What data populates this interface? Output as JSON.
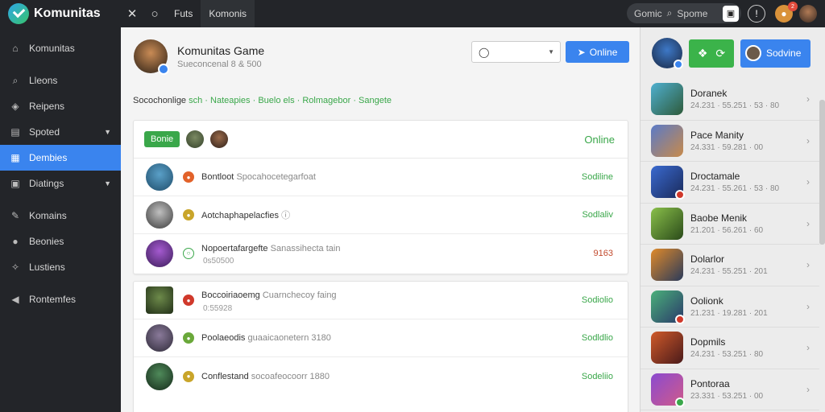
{
  "topbar": {
    "brand": "Komunitas",
    "links": [
      "Futs",
      "Komonis"
    ],
    "search_label": "Gomic",
    "search_placeholder": "Spome"
  },
  "sidebar": {
    "items": [
      {
        "label": "Komunitas",
        "icon": "home-icon"
      },
      {
        "label": "Lleons",
        "icon": "search-icon"
      },
      {
        "label": "Reipens",
        "icon": "shield-icon"
      },
      {
        "label": "Spoted",
        "icon": "store-icon",
        "caret": true
      },
      {
        "label": "Dembies",
        "icon": "tag-icon",
        "active": true
      },
      {
        "label": "Diatings",
        "icon": "calendar-icon",
        "caret": true
      },
      {
        "label": "Komains",
        "icon": "wrench-icon"
      },
      {
        "label": "Beonies",
        "icon": "user-icon"
      },
      {
        "label": "Lustiens",
        "icon": "group-icon"
      },
      {
        "label": "Rontemfes",
        "icon": "send-icon"
      }
    ]
  },
  "profile": {
    "title": "Komunitas Game",
    "subtitle": "Sueconcenal 8 & 500",
    "select_value": "",
    "online_button": "Online"
  },
  "tagline": {
    "part1": "Socochonlige",
    "part2": "sch · Nateapies · Buelo els · Rolmagebor · Sangete"
  },
  "card1": {
    "pill": "Bonie",
    "status": "Online",
    "rows": [
      {
        "text": "Bontloot",
        "muted": "Spocahocetegarfoat",
        "right": "Sodiline",
        "sub": ""
      },
      {
        "text": "Aotchaphapelacfies",
        "muted": "",
        "right": "Sodlaliv",
        "sub": ""
      },
      {
        "text": "Nopoertafargefte",
        "muted": "Sanassihecta tain",
        "right": "9163",
        "sub": "0s50500"
      }
    ]
  },
  "card2": {
    "rows": [
      {
        "text": "Boccoiriaoemg",
        "muted": "Cuarnchecoy faing",
        "right": "Sodiolio",
        "sub": "0:55928"
      },
      {
        "text": "Poolaeodis",
        "muted": "guaaicaonetern 3180",
        "right": "Sodldlio",
        "sub": ""
      },
      {
        "text": "Conflestand",
        "muted": "socoafeocoorr 1880",
        "right": "Sodeliio",
        "sub": ""
      }
    ]
  },
  "rpanel": {
    "button_label": "Sodvine",
    "items": [
      {
        "name": "Doranek",
        "meta": "24.231 · 55.251 · 53 · 80"
      },
      {
        "name": "Pace Manity",
        "meta": "24.331 · 59.281 · 00"
      },
      {
        "name": "Droctamale",
        "meta": "24.231 · 55.261 · 53 · 80"
      },
      {
        "name": "Baobe Menik",
        "meta": "21.201 · 56.261 · 60"
      },
      {
        "name": "Dolarlor",
        "meta": "24.231 · 55.251 · 201"
      },
      {
        "name": "Oolionk",
        "meta": "21.231 · 19.281 · 201"
      },
      {
        "name": "Dopmils",
        "meta": "24.231 · 53.251 · 80"
      },
      {
        "name": "Pontoraa",
        "meta": "23.331 · 53.251 · 00"
      }
    ]
  }
}
